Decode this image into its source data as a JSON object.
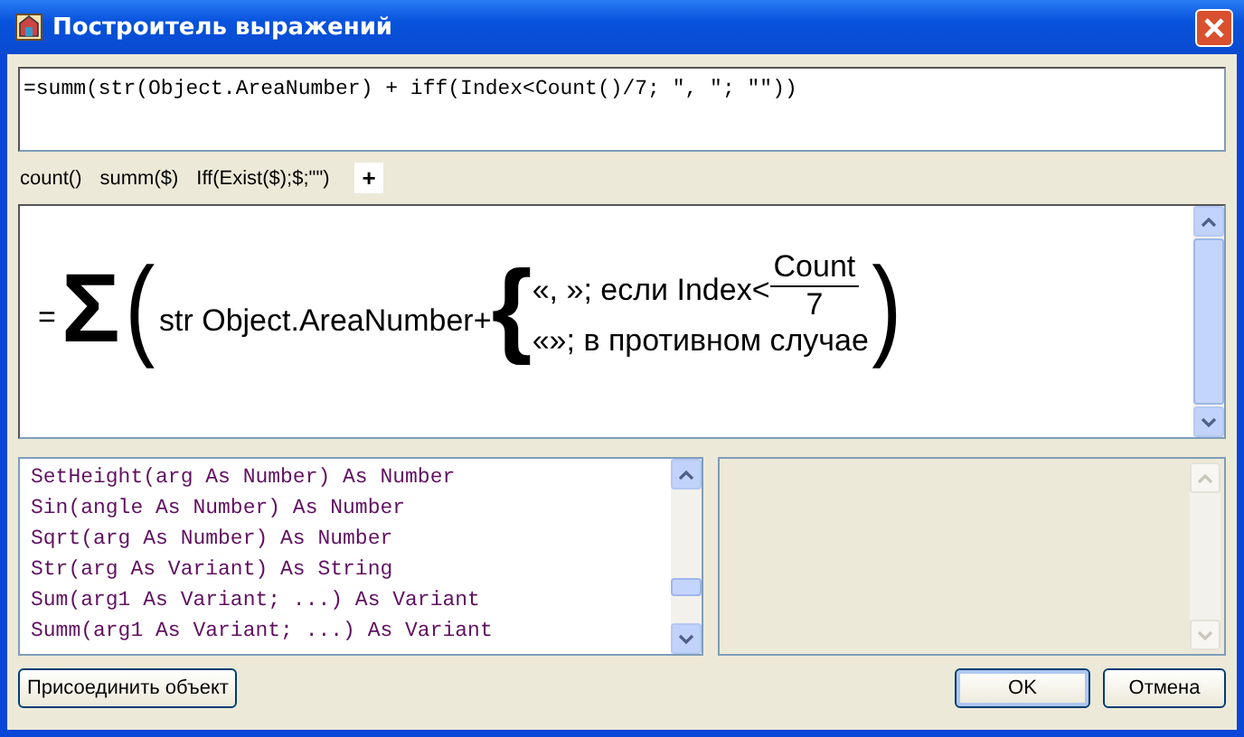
{
  "window": {
    "title": "Построитель выражений"
  },
  "editor": {
    "value": "=summ(str(Object.AreaNumber) + iff(Index<Count()/7; \", \"; \"\"))"
  },
  "toolbar": {
    "snippets": [
      "count()",
      "summ($)",
      "Iff(Exist($);$;\"\")"
    ],
    "add_button": "+"
  },
  "formula": {
    "equals": "=",
    "sigma": "Σ",
    "open_paren": "(",
    "body": "str Object.AreaNumber+",
    "brace": "{",
    "cases": [
      {
        "text": "«, »; если Index<",
        "numerator": "Count",
        "denominator": "7"
      },
      {
        "text": "«»; в противном случае"
      }
    ],
    "close_paren": ")"
  },
  "functions": [
    "SetHeight(arg As Number) As Number",
    "Sin(angle As Number) As Number",
    "Sqrt(arg As Number) As Number",
    "Str(arg As Variant) As String",
    "Sum(arg1 As Variant; ...) As Variant",
    "Summ(arg1 As Variant; ...) As Variant"
  ],
  "buttons": {
    "attach": "Присоединить объект",
    "ok": "OK",
    "cancel": "Отмена"
  }
}
